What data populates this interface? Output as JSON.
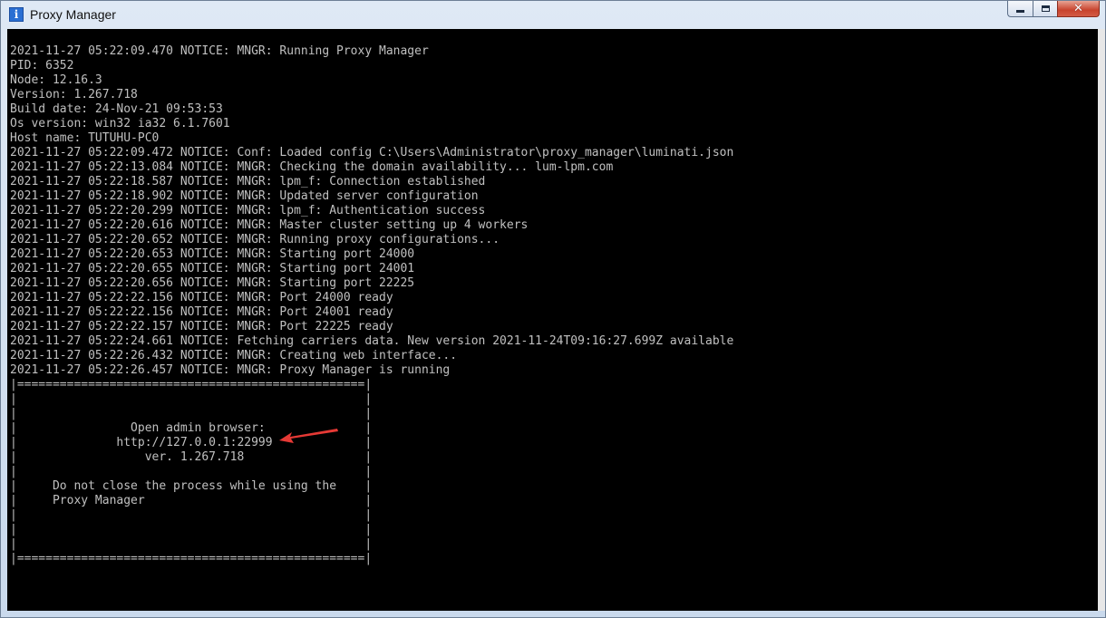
{
  "window": {
    "title": "Proxy Manager",
    "app_icon_glyph": "i",
    "controls": {
      "minimize": "minimize-icon",
      "maximize": "maximize-icon",
      "close": "✕"
    }
  },
  "colors": {
    "console_bg": "#000000",
    "console_text": "#c0c0c0",
    "arrow": "#e53935"
  },
  "console": {
    "lines": [
      "2021-11-27 05:22:09.470 NOTICE: MNGR: Running Proxy Manager",
      "PID: 6352",
      "Node: 12.16.3",
      "Version: 1.267.718",
      "Build date: 24-Nov-21 09:53:53",
      "Os version: win32 ia32 6.1.7601",
      "Host name: TUTUHU-PC0",
      "2021-11-27 05:22:09.472 NOTICE: Conf: Loaded config C:\\Users\\Administrator\\proxy_manager\\luminati.json",
      "2021-11-27 05:22:13.084 NOTICE: MNGR: Checking the domain availability... lum-lpm.com",
      "2021-11-27 05:22:18.587 NOTICE: MNGR: lpm_f: Connection established",
      "2021-11-27 05:22:18.902 NOTICE: MNGR: Updated server configuration",
      "2021-11-27 05:22:20.299 NOTICE: MNGR: lpm_f: Authentication success",
      "2021-11-27 05:22:20.616 NOTICE: MNGR: Master cluster setting up 4 workers",
      "2021-11-27 05:22:20.652 NOTICE: MNGR: Running proxy configurations...",
      "2021-11-27 05:22:20.653 NOTICE: MNGR: Starting port 24000",
      "2021-11-27 05:22:20.655 NOTICE: MNGR: Starting port 24001",
      "2021-11-27 05:22:20.656 NOTICE: MNGR: Starting port 22225",
      "2021-11-27 05:22:22.156 NOTICE: MNGR: Port 24000 ready",
      "2021-11-27 05:22:22.156 NOTICE: MNGR: Port 24001 ready",
      "2021-11-27 05:22:22.157 NOTICE: MNGR: Port 22225 ready",
      "2021-11-27 05:22:24.661 NOTICE: Fetching carriers data. New version 2021-11-24T09:16:27.699Z available",
      "2021-11-27 05:22:26.432 NOTICE: MNGR: Creating web interface...",
      "2021-11-27 05:22:26.457 NOTICE: MNGR: Proxy Manager is running",
      "|=================================================|",
      "|                                                 |",
      "|                                                 |",
      "|                Open admin browser:              |",
      "|              http://127.0.0.1:22999             |",
      "|                  ver. 1.267.718                 |",
      "|                                                 |",
      "|     Do not close the process while using the    |",
      "|     Proxy Manager                               |",
      "|                                                 |",
      "|                                                 |",
      "|                                                 |",
      "|=================================================|"
    ]
  },
  "annotation": {
    "arrow_icon": "red-arrow-icon"
  }
}
